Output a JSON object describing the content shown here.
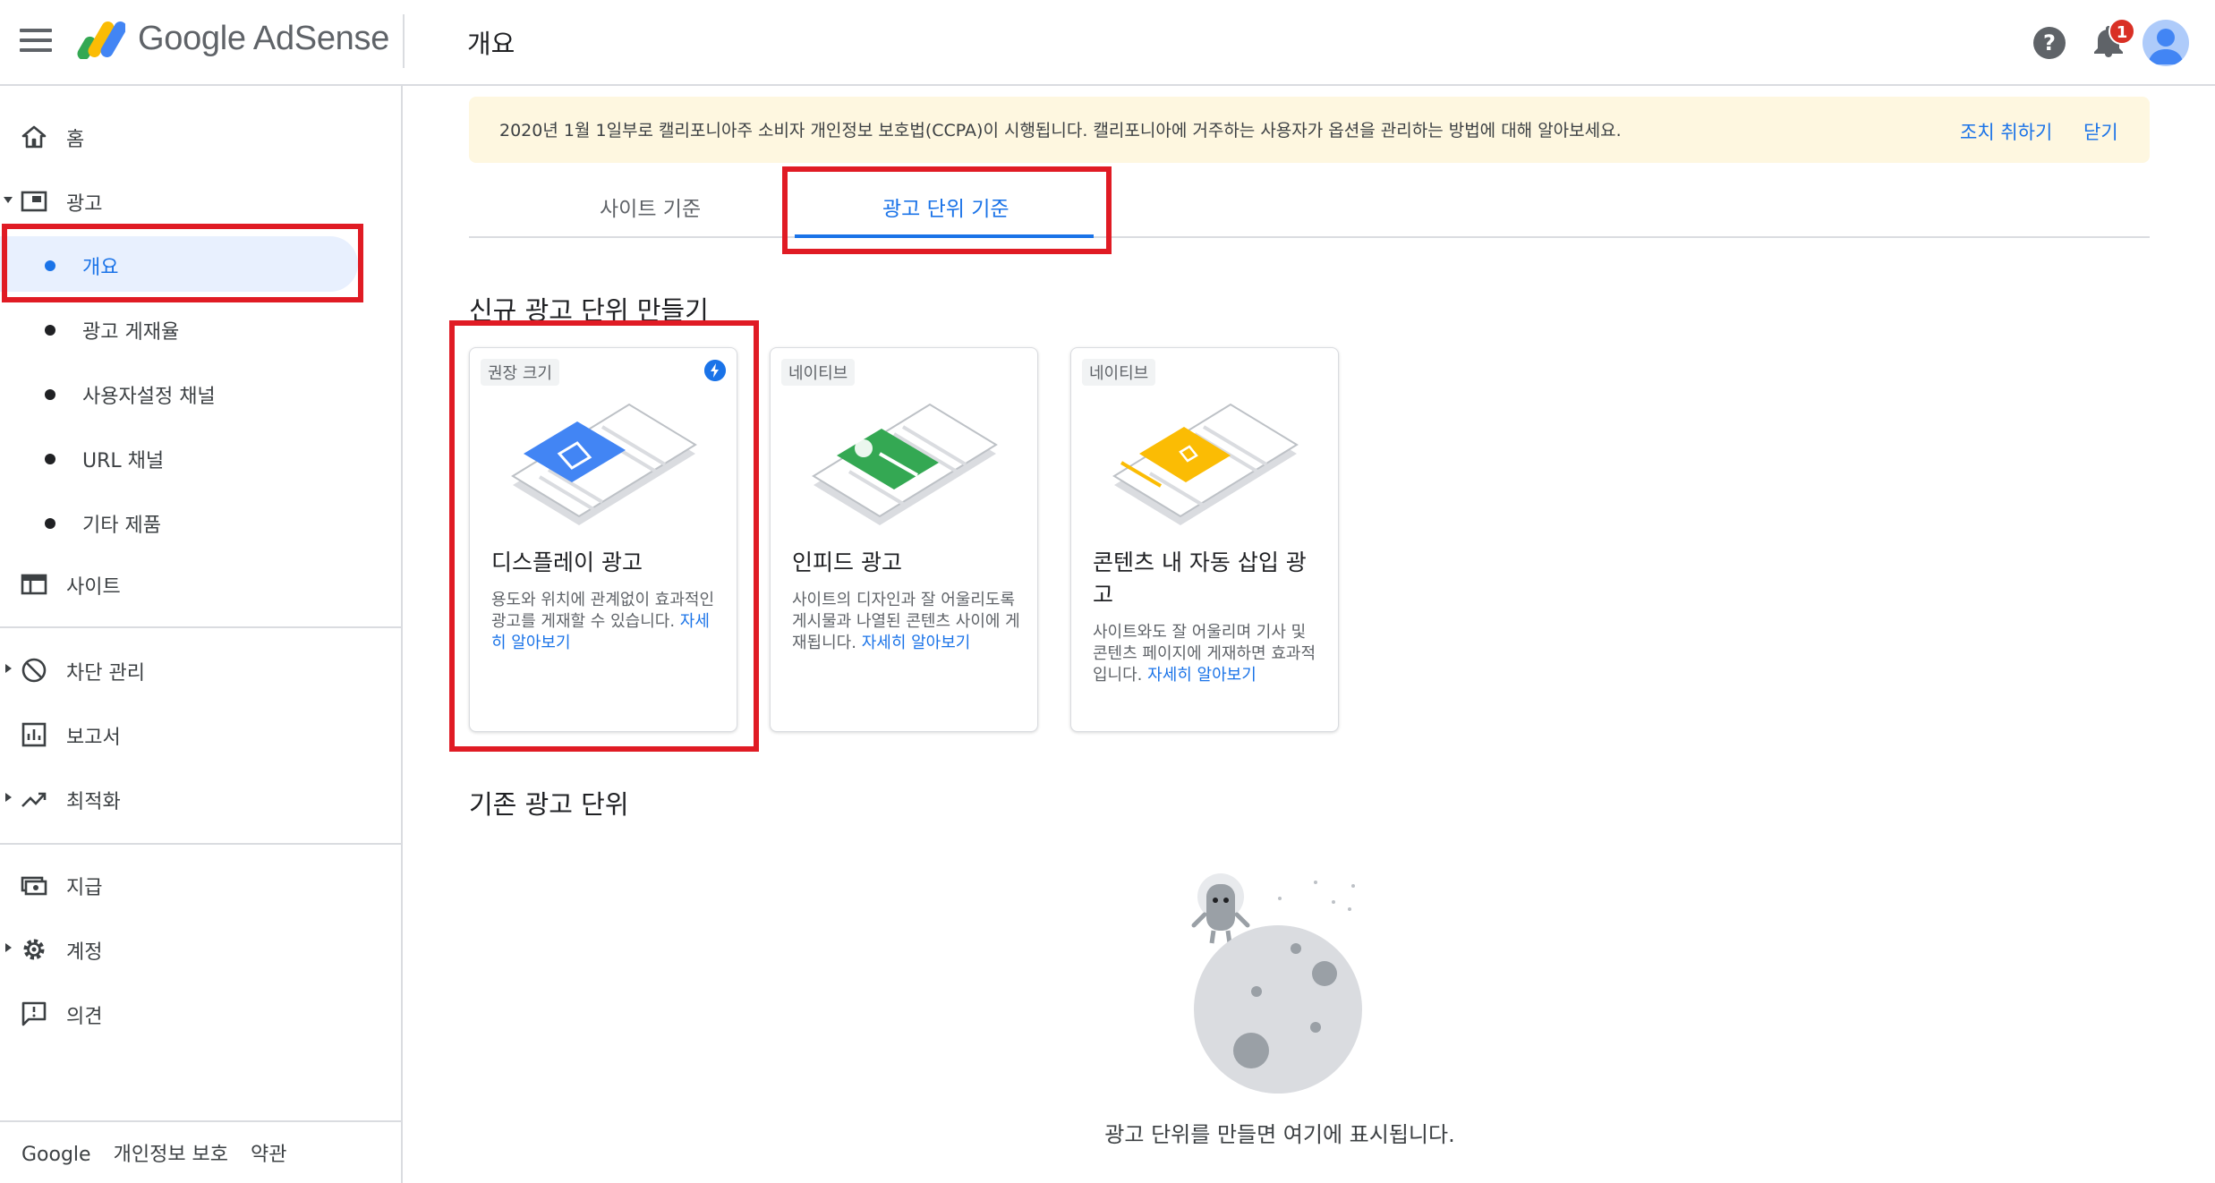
{
  "app": {
    "brand": "Google AdSense",
    "page_title": "개요"
  },
  "header": {
    "notification_count": "1"
  },
  "sidebar": {
    "items": [
      {
        "id": "home",
        "label": "홈"
      },
      {
        "id": "ads",
        "label": "광고"
      },
      {
        "id": "sites",
        "label": "사이트"
      },
      {
        "id": "blocking",
        "label": "차단 관리"
      },
      {
        "id": "reports",
        "label": "보고서"
      },
      {
        "id": "optimization",
        "label": "최적화"
      },
      {
        "id": "payments",
        "label": "지급"
      },
      {
        "id": "account",
        "label": "계정"
      },
      {
        "id": "feedback",
        "label": "의견"
      }
    ],
    "ads_subitems": [
      {
        "label": "개요"
      },
      {
        "label": "광고 게재율"
      },
      {
        "label": "사용자설정 채널"
      },
      {
        "label": "URL 채널"
      },
      {
        "label": "기타 제품"
      }
    ],
    "footer": {
      "google": "Google",
      "privacy": "개인정보 보호",
      "terms": "약관"
    }
  },
  "banner": {
    "text": "2020년 1월 1일부로 캘리포니아주 소비자 개인정보 보호법(CCPA)이 시행됩니다. 캘리포니아에 거주하는 사용자가 옵션을 관리하는 방법에 대해 알아보세요.",
    "action_label": "조치 취하기",
    "close_label": "닫기"
  },
  "tabs": [
    {
      "label": "사이트 기준"
    },
    {
      "label": "광고 단위 기준"
    }
  ],
  "new_ad_units": {
    "title": "신규 광고 단위 만들기",
    "cards": [
      {
        "chip": "권장 크기",
        "title": "디스플레이 광고",
        "desc": "용도와 위치에 관계없이 효과적인 광고를 게재할 수 있습니다.",
        "link": "자세히 알아보기",
        "accent": "#4285f4"
      },
      {
        "chip": "네이티브",
        "title": "인피드 광고",
        "desc": "사이트의 디자인과 잘 어울리도록 게시물과 나열된 콘텐츠 사이에 게재됩니다.",
        "link": "자세히 알아보기",
        "accent": "#34a853"
      },
      {
        "chip": "네이티브",
        "title": "콘텐츠 내 자동 삽입 광고",
        "desc": "사이트와도 잘 어울리며 기사 및 콘텐츠 페이지에 게재하면 효과적입니다.",
        "link": "자세히 알아보기",
        "accent": "#fbbc04"
      }
    ]
  },
  "existing_ad_units": {
    "title": "기존 광고 단위",
    "empty_text": "광고 단위를 만들면 여기에 표시됩니다."
  },
  "colors": {
    "primary": "#1a73e8",
    "highlight": "#e01b24",
    "banner_bg": "#fef7e0"
  }
}
